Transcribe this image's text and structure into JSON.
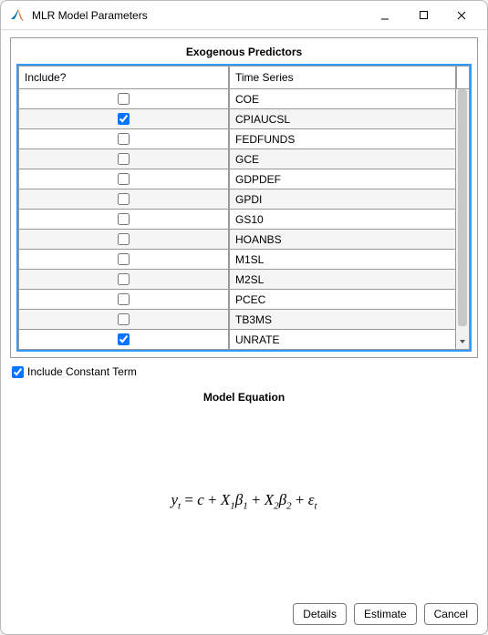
{
  "window_title": "MLR Model Parameters",
  "group_title": "Exogenous Predictors",
  "columns": {
    "include": "Include?",
    "series": "Time Series"
  },
  "rows": [
    {
      "checked": false,
      "series": "COE"
    },
    {
      "checked": true,
      "series": "CPIAUCSL"
    },
    {
      "checked": false,
      "series": "FEDFUNDS"
    },
    {
      "checked": false,
      "series": "GCE"
    },
    {
      "checked": false,
      "series": "GDPDEF"
    },
    {
      "checked": false,
      "series": "GPDI"
    },
    {
      "checked": false,
      "series": "GS10"
    },
    {
      "checked": false,
      "series": "HOANBS"
    },
    {
      "checked": false,
      "series": "M1SL"
    },
    {
      "checked": false,
      "series": "M2SL"
    },
    {
      "checked": false,
      "series": "PCEC"
    },
    {
      "checked": false,
      "series": "TB3MS"
    },
    {
      "checked": true,
      "series": "UNRATE"
    }
  ],
  "constant_term": {
    "checked": true,
    "label": "Include Constant Term"
  },
  "equation_title": "Model Equation",
  "buttons": {
    "details": "Details",
    "estimate": "Estimate",
    "cancel": "Cancel"
  }
}
